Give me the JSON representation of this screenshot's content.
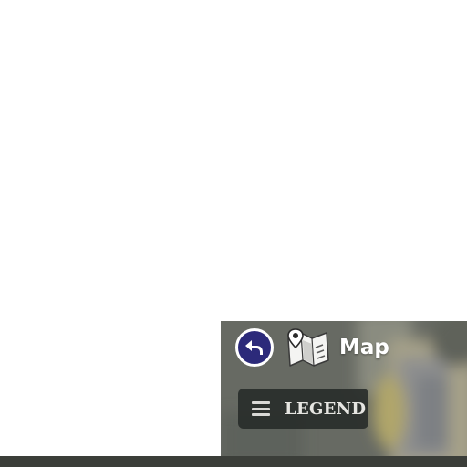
{
  "header": {
    "title": "Map",
    "back_icon": "back-arrow-icon",
    "map_icon": "folded-map-icon"
  },
  "legend": {
    "label": "LEGEND",
    "icon": "hamburger-menu-icon"
  },
  "colors": {
    "back_button": "#2c2a7a",
    "legend_bg": "#262a28",
    "panel_bg": "#6b6e66"
  }
}
